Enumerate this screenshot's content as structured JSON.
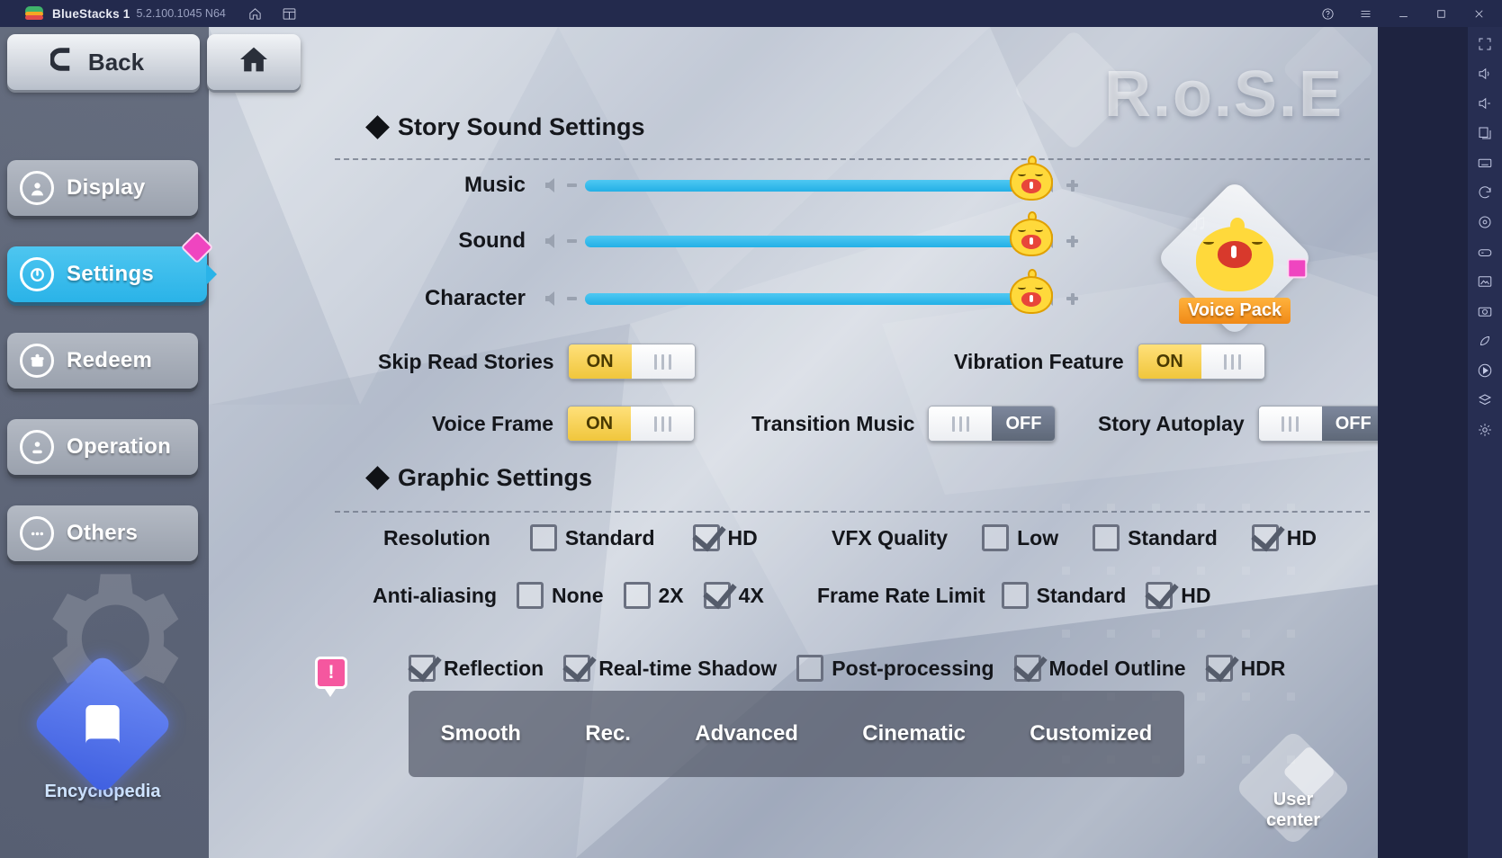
{
  "titlebar": {
    "app_name": "BlueStacks 1",
    "version": "5.2.100.1045 N64",
    "icons": [
      "bluestacks-logo",
      "home-icon",
      "multi-instance-icon"
    ],
    "right_buttons": [
      "help-icon",
      "menu-icon",
      "minimize-icon",
      "maximize-icon",
      "close-icon"
    ]
  },
  "right_toolbar": {
    "items": [
      "fullscreen-icon",
      "volume-up-icon",
      "volume-down-icon",
      "copy-icon",
      "keyboard-icon",
      "rotate-icon",
      "location-icon",
      "controls-icon",
      "gallery-icon",
      "camera-icon",
      "eco-mode-icon",
      "macro-icon",
      "layers-icon",
      "settings-icon"
    ]
  },
  "nav": {
    "back_label": "Back",
    "home_label": "",
    "items": [
      {
        "label": "Display",
        "icon": "user-circle-icon",
        "active": false,
        "badge": false
      },
      {
        "label": "Settings",
        "icon": "power-circle-icon",
        "active": true,
        "badge": true
      },
      {
        "label": "Redeem",
        "icon": "gift-circle-icon",
        "active": false,
        "badge": false
      },
      {
        "label": "Operation",
        "icon": "joystick-circle-icon",
        "active": false,
        "badge": false
      },
      {
        "label": "Others",
        "icon": "ellipsis-circle-icon",
        "active": false,
        "badge": false
      }
    ],
    "encyclopedia_label": "Encyclopedia"
  },
  "watermark": {
    "title": "R.o.S.E"
  },
  "sound_section": {
    "title": "Story Sound Settings",
    "sliders": [
      {
        "label": "Music",
        "value": 100
      },
      {
        "label": "Sound",
        "value": 100
      },
      {
        "label": "Character",
        "value": 100
      }
    ],
    "toggles": [
      {
        "label": "Skip Read Stories",
        "state": "ON",
        "on_label": "ON",
        "off_label": "OFF"
      },
      {
        "label": "Vibration Feature",
        "state": "ON",
        "on_label": "ON",
        "off_label": "OFF"
      },
      {
        "label": "Voice Frame",
        "state": "ON",
        "on_label": "ON",
        "off_label": "OFF"
      },
      {
        "label": "Transition Music",
        "state": "OFF",
        "on_label": "ON",
        "off_label": "OFF"
      },
      {
        "label": "Story Autoplay",
        "state": "OFF",
        "on_label": "ON",
        "off_label": "OFF"
      }
    ],
    "voice_pack_label": "Voice Pack"
  },
  "graphic_section": {
    "title": "Graphic Settings",
    "rows": [
      {
        "label": "Resolution",
        "options": [
          {
            "text": "Standard",
            "checked": false
          },
          {
            "text": "HD",
            "checked": true
          }
        ]
      },
      {
        "label": "VFX Quality",
        "options": [
          {
            "text": "Low",
            "checked": false
          },
          {
            "text": "Standard",
            "checked": false
          },
          {
            "text": "HD",
            "checked": true
          }
        ]
      },
      {
        "label": "Anti-aliasing",
        "options": [
          {
            "text": "None",
            "checked": false
          },
          {
            "text": "2X",
            "checked": false
          },
          {
            "text": "4X",
            "checked": true
          }
        ]
      },
      {
        "label": "Frame Rate Limit",
        "options": [
          {
            "text": "Standard",
            "checked": false
          },
          {
            "text": "HD",
            "checked": true
          }
        ]
      }
    ],
    "features": [
      {
        "text": "Reflection",
        "checked": true
      },
      {
        "text": "Real-time Shadow",
        "checked": true
      },
      {
        "text": "Post-processing",
        "checked": false
      },
      {
        "text": "Model Outline",
        "checked": true
      },
      {
        "text": "HDR",
        "checked": true
      }
    ],
    "presets": [
      {
        "label": "Smooth",
        "selected": false,
        "alert": true
      },
      {
        "label": "Rec.",
        "selected": false,
        "alert": false
      },
      {
        "label": "Advanced",
        "selected": false,
        "alert": false
      },
      {
        "label": "Cinematic",
        "selected": false,
        "alert": false
      },
      {
        "label": "Customized",
        "selected": true,
        "alert": false
      }
    ],
    "alert_badge_text": "!"
  },
  "user_center": {
    "line1": "User",
    "line2": "center"
  },
  "colors": {
    "accent_cyan": "#2ab3e8",
    "accent_pink": "#e84bc8",
    "toggle_on": "#f0c63c",
    "toggle_off": "#5e6878",
    "titlebar": "#232a4d"
  }
}
